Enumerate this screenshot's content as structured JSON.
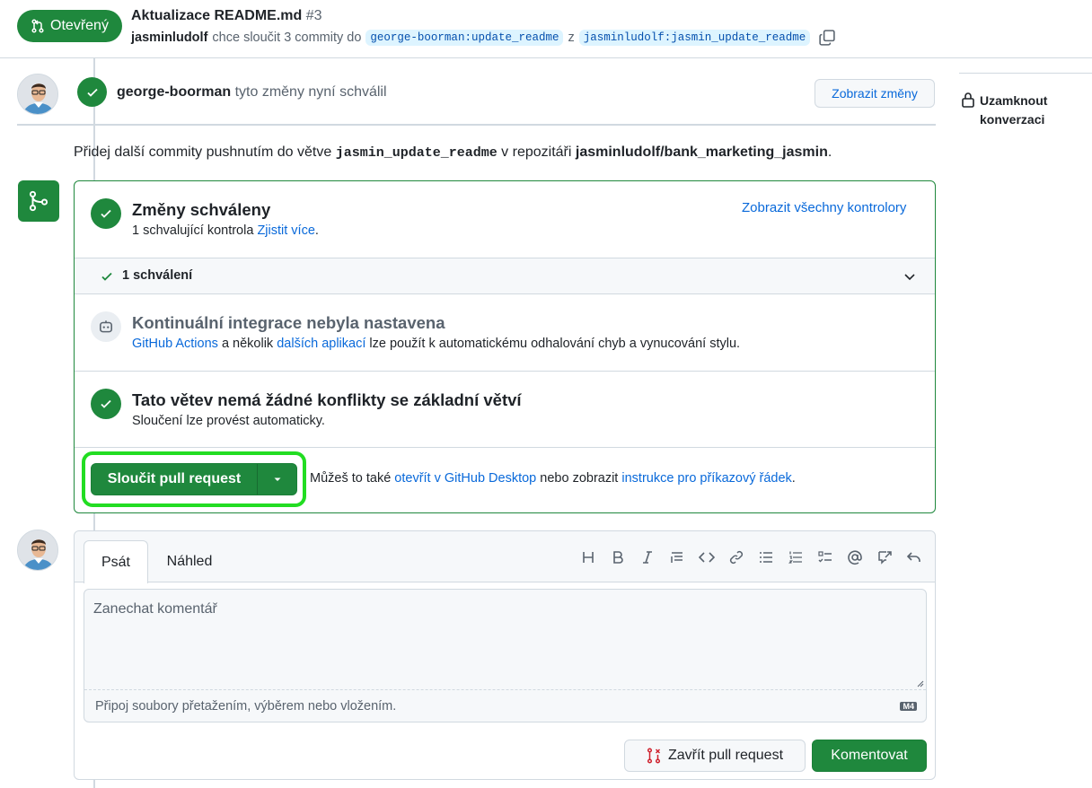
{
  "header": {
    "state": "Otevřený",
    "title": "Aktualizace README.md",
    "number": "#3",
    "author": "jasminludolf",
    "action_text": "chce sloučit 3 commity do",
    "base_branch": "george-boorman:update_readme",
    "from_word": "z",
    "head_branch": "jasminludolf:jasmin_update_readme"
  },
  "review": {
    "reviewer": "george-boorman",
    "text": "tyto změny nyní schválil",
    "view_changes": "Zobrazit změny"
  },
  "push_hint": {
    "prefix": "Přidej další commity pushnutím do větve",
    "branch": "jasmin_update_readme",
    "middle": "v repozitáři",
    "repo": "jasminludolf/bank_marketing_jasmin",
    "suffix": "."
  },
  "sidebar": {
    "lock_line1": "Uzamknout",
    "lock_line2": "konverzaci"
  },
  "merge_box": {
    "approved_title": "Změny schváleny",
    "approved_desc": "1 schvalující kontrola",
    "learn_more": "Zjistit více",
    "period": ".",
    "all_reviewers": "Zobrazit všechny kontrolory",
    "approvals_label": "1 schválení",
    "ci_title": "Kontinuální integrace nebyla nastavena",
    "ci_link1": "GitHub Actions",
    "ci_mid": "a několik",
    "ci_link2": "dalších aplikací",
    "ci_rest": "lze použít k automatickému odhalování chyb a vynucování stylu.",
    "conflict_title": "Tato větev nemá žádné konflikty se základní větví",
    "conflict_desc": "Sloučení lze provést automaticky.",
    "merge_button": "Sloučit pull request",
    "alt_prefix": "Můžeš to také",
    "alt_link1": "otevřít v GitHub Desktop",
    "alt_mid": "nebo zobrazit",
    "alt_link2": "instrukce pro příkazový řádek",
    "alt_suffix": "."
  },
  "comment": {
    "tab_write": "Psát",
    "tab_preview": "Náhled",
    "placeholder": "Zanechat komentář",
    "attach_hint": "Připoj soubory přetažením, výběrem nebo vložením.",
    "md_badge": "M4",
    "close_pr": "Zavřít pull request",
    "comment_button": "Komentovat",
    "toolbar": [
      "heading-icon",
      "bold-icon",
      "italic-icon",
      "quote-icon",
      "code-icon",
      "link-icon",
      "unordered-list-icon",
      "ordered-list-icon",
      "task-list-icon",
      "mention-icon",
      "reference-icon",
      "undo-icon"
    ]
  },
  "colors": {
    "accent_green": "#1f883d",
    "link_blue": "#0969da",
    "highlight": "#22dd22"
  }
}
